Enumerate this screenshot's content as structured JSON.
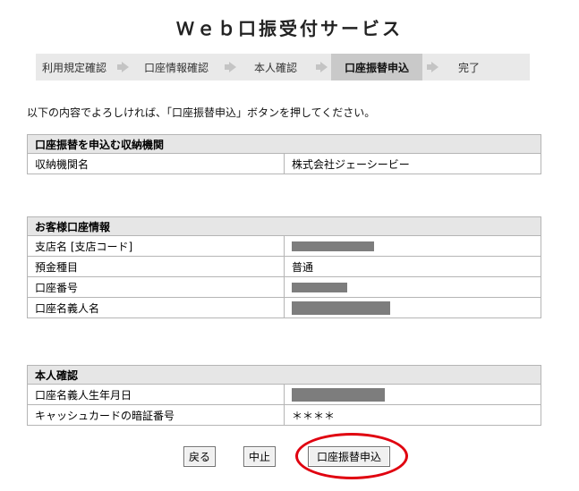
{
  "title": "Ｗｅｂ口振受付サービス",
  "steps": [
    {
      "label": "利用規定確認",
      "active": false
    },
    {
      "label": "口座情報確認",
      "active": false
    },
    {
      "label": "本人確認",
      "active": false
    },
    {
      "label": "口座振替申込",
      "active": true
    },
    {
      "label": "完了",
      "active": false
    }
  ],
  "instruction": "以下の内容でよろしければ、「口座振替申込」ボタンを押してください。",
  "section1": {
    "heading": "口座振替を申込む収納機関",
    "rows": [
      {
        "label": "収納機関名",
        "value": "株式会社ジェーシービー"
      }
    ]
  },
  "section2": {
    "heading": "お客様口座情報",
    "rows": [
      {
        "label": "支店名 [支店コード]",
        "value": ""
      },
      {
        "label": "預金種目",
        "value": "普通"
      },
      {
        "label": "口座番号",
        "value": ""
      },
      {
        "label": "口座名義人名",
        "value": ""
      }
    ]
  },
  "section3": {
    "heading": "本人確認",
    "rows": [
      {
        "label": "口座名義人生年月日",
        "value": ""
      },
      {
        "label": "キャッシュカードの暗証番号",
        "value": "＊＊＊＊"
      }
    ]
  },
  "buttons": {
    "back": "戻る",
    "cancel": "中止",
    "submit": "口座振替申込"
  },
  "colors": {
    "highlight": "#e0000f",
    "header_bg": "#e6e6e6",
    "active_step_bg": "#c9c9c9"
  }
}
